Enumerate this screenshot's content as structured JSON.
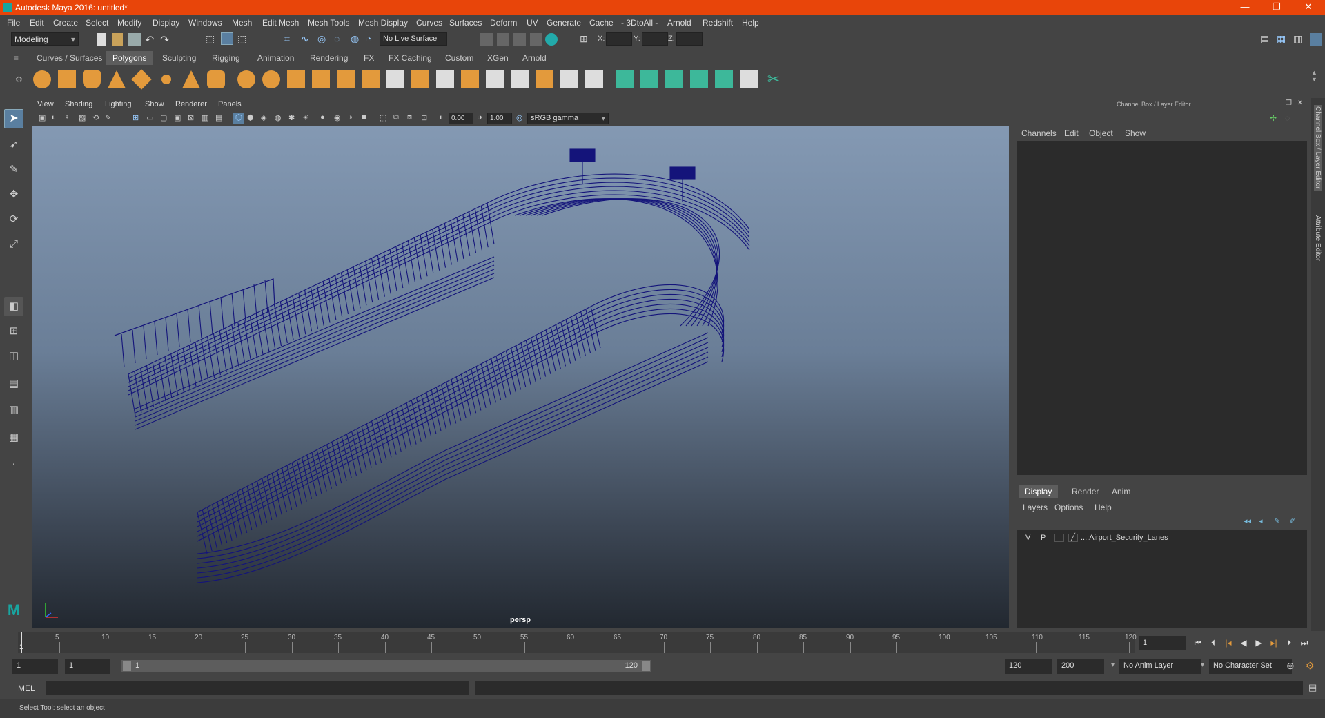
{
  "titlebar": {
    "title": "Autodesk Maya 2016: untitled*",
    "controls": {
      "minimize": "—",
      "maximize": "❐",
      "close": "✕"
    }
  },
  "menubar": {
    "items": [
      "File",
      "Edit",
      "Create",
      "Select",
      "Modify",
      "Display",
      "Windows",
      "Mesh",
      "Edit Mesh",
      "Mesh Tools",
      "Mesh Display",
      "Curves",
      "Surfaces",
      "Deform",
      "UV",
      "Generate",
      "Cache",
      "- 3DtoAll -",
      "Arnold",
      "Redshift",
      "Help"
    ]
  },
  "statusline": {
    "mode": "Modeling",
    "live_surface": "No Live Surface",
    "x_label": "X:",
    "y_label": "Y:",
    "z_label": "Z:"
  },
  "shelf": {
    "tabs": [
      "Curves / Surfaces",
      "Polygons",
      "Sculpting",
      "Rigging",
      "Animation",
      "Rendering",
      "FX",
      "FX Caching",
      "Custom",
      "XGen",
      "Arnold"
    ],
    "active_tab": "Polygons"
  },
  "viewport": {
    "menu": [
      "View",
      "Shading",
      "Lighting",
      "Show",
      "Renderer",
      "Panels"
    ],
    "exposure": "0.00",
    "gamma": "1.00",
    "color_space": "sRGB gamma",
    "camera_label": "persp",
    "wire_color": "#14147a"
  },
  "channelbox": {
    "title": "Channel Box / Layer Editor",
    "menu": [
      "Channels",
      "Edit",
      "Object",
      "Show"
    ]
  },
  "layer_editor": {
    "tabs": [
      "Display",
      "Render",
      "Anim"
    ],
    "active_tab": "Display",
    "menu": [
      "Layers",
      "Options",
      "Help"
    ],
    "layers": [
      {
        "v": "V",
        "p": "P",
        "name": "...:Airport_Security_Lanes"
      }
    ]
  },
  "side_tabs": [
    "Channel Box / Layer Editor",
    "Attribute Editor"
  ],
  "timeline": {
    "ticks": [
      "5",
      "10",
      "15",
      "20",
      "25",
      "30",
      "35",
      "40",
      "45",
      "50",
      "55",
      "60",
      "65",
      "70",
      "75",
      "80",
      "85",
      "90",
      "95",
      "100",
      "105",
      "110",
      "115",
      "120"
    ],
    "first_label": "1",
    "current_frame": "1"
  },
  "range": {
    "start": "1",
    "playback_start": "1",
    "slider_start": "1",
    "slider_end": "120",
    "playback_end": "120",
    "end": "200",
    "anim_layer": "No Anim Layer",
    "character_set": "No Character Set"
  },
  "cmdline": {
    "label": "MEL"
  },
  "helpline": {
    "text": "Select Tool: select an object"
  }
}
